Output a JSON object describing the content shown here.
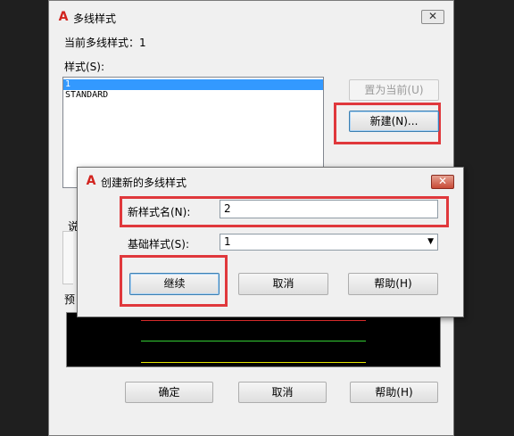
{
  "main_dialog": {
    "title": "多线样式",
    "close_glyph": "✕",
    "current_style_label": "当前多线样式：1",
    "styles_label": "样式(S):",
    "styles": [
      "1",
      "STANDARD"
    ],
    "selected_style": "1",
    "set_current_button": "置为当前(U)",
    "new_button": "新建(N)...",
    "partial_label_1": "说",
    "preview_label": "预",
    "ok_button": "确定",
    "cancel_button": "取消",
    "help_button": "帮助(H)"
  },
  "sub_dialog": {
    "title": "创建新的多线样式",
    "close_glyph": "✕",
    "new_name_label": "新样式名(N):",
    "new_name_value": "2",
    "base_style_label": "基础样式(S):",
    "base_style_value": "1",
    "continue_button": "继续",
    "cancel_button": "取消",
    "help_button": "帮助(H)"
  },
  "colors": {
    "highlight": "#e0383c",
    "preview_red": "#ff3333",
    "preview_green": "#33cc33",
    "preview_yellow": "#e6e600",
    "selection": "#3399ff"
  }
}
